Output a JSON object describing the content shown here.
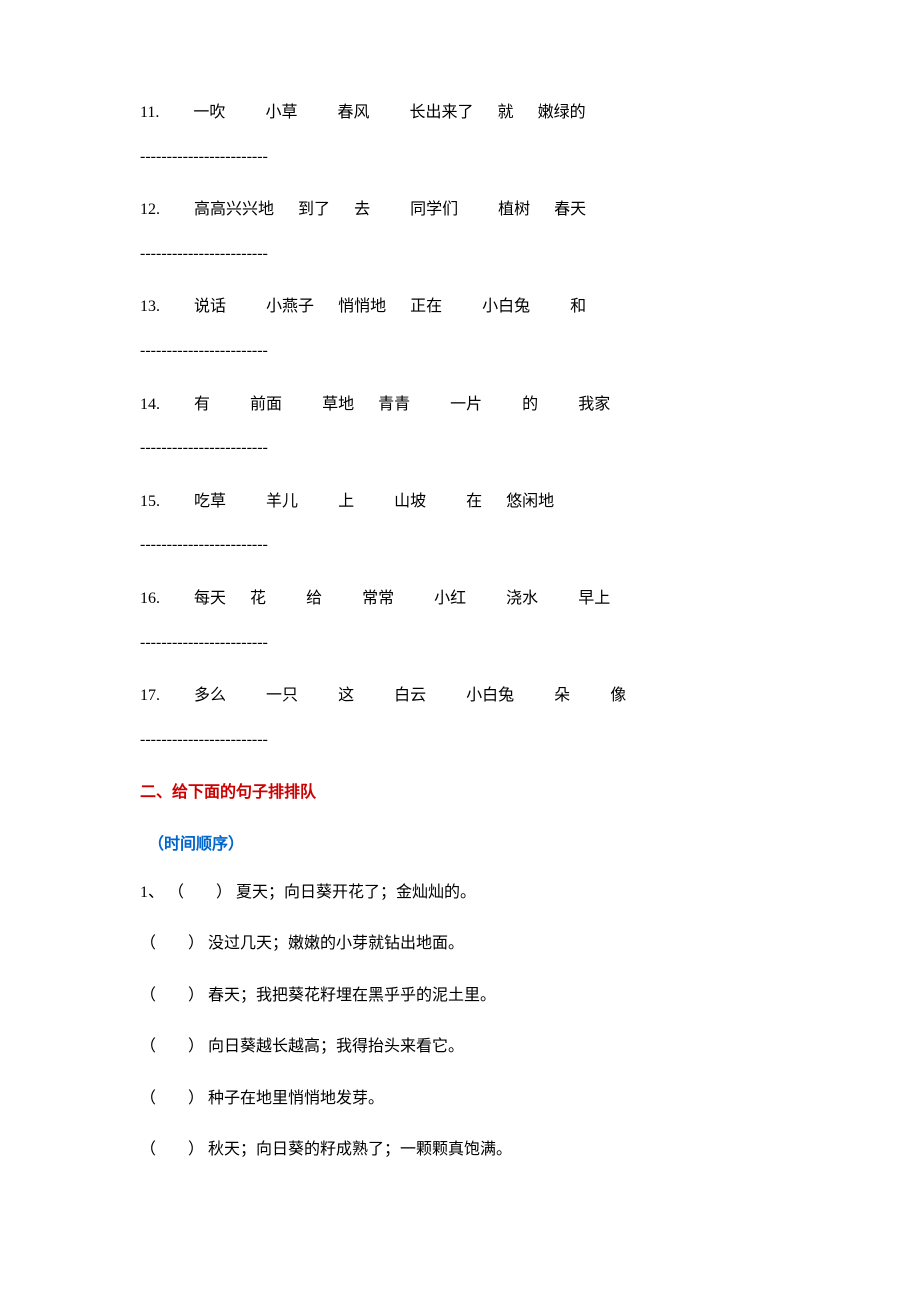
{
  "questions": [
    {
      "num": "11.",
      "words": [
        "一吹",
        "小草",
        "春风",
        "长出来了",
        "就",
        "嫩绿的"
      ]
    },
    {
      "num": "12.",
      "words": [
        "高高兴兴地",
        "到了",
        "去",
        "同学们",
        "植树",
        "春天"
      ]
    },
    {
      "num": "13.",
      "words": [
        "说话",
        "小燕子",
        "悄悄地",
        "正在",
        "小白兔",
        "和"
      ]
    },
    {
      "num": "14.",
      "words": [
        "有",
        "前面",
        "草地",
        "青青",
        "一片",
        "的",
        "我家"
      ]
    },
    {
      "num": "15.",
      "words": [
        "吃草",
        "羊儿",
        "上",
        "山坡",
        "在",
        "悠闲地"
      ]
    },
    {
      "num": "16.",
      "words": [
        "每天",
        "花",
        "给",
        "常常",
        "小红",
        "浇水",
        "早上"
      ]
    },
    {
      "num": "17.",
      "words": [
        "多么",
        "一只",
        "这",
        "白云",
        "小白兔",
        "朵",
        "像"
      ]
    }
  ],
  "dash_line": "------------------------",
  "section2": {
    "title": "二、给下面的句子排排队",
    "note": "（时间顺序）",
    "intro_num": "1、",
    "blank": "（　　）",
    "lines": [
      "夏天；向日葵开花了；金灿灿的。",
      "没过几天；嫩嫩的小芽就钻出地面。",
      "春天；我把葵花籽埋在黑乎乎的泥土里。",
      "向日葵越长越高；我得抬头来看它。",
      "种子在地里悄悄地发芽。",
      "秋天；向日葵的籽成熟了；一颗颗真饱满。"
    ]
  }
}
